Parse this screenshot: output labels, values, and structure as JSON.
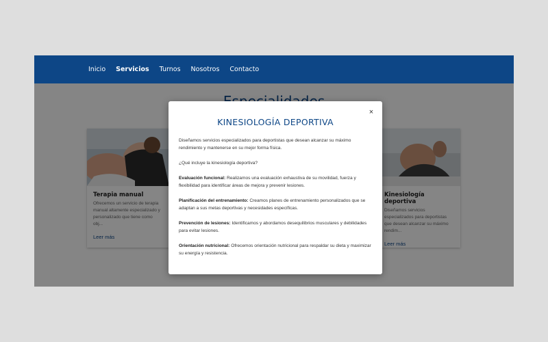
{
  "nav": {
    "items": [
      {
        "label": "Inicio",
        "active": false
      },
      {
        "label": "Servicios",
        "active": true
      },
      {
        "label": "Turnos",
        "active": false
      },
      {
        "label": "Nosotros",
        "active": false
      },
      {
        "label": "Contacto",
        "active": false
      }
    ]
  },
  "section": {
    "title": "Especialidades"
  },
  "cards": [
    {
      "title": "Terapia manual",
      "text": "Ofrecemos un servicio de terapia manual altamente especializado y personalizado que tiene como obj...",
      "link": "Leer más"
    },
    {
      "title": "Kinesiología deportiva",
      "text": "Diseñamos servicios especializados para deportistas que desean alcanzar su máximo rendim...",
      "link": "Leer más"
    }
  ],
  "modal": {
    "title": "KINESIOLOGÍA DEPORTIVA",
    "close": "×",
    "intro": "Diseñamos servicios especializados para deportistas que desean alcanzar su máximo rendimiento y mantenerse en su mejor forma física.",
    "question": "¿Qué incluye la kinesiología deportiva?",
    "items": [
      {
        "heading": "Evaluación funcional:",
        "text": " Realizamos una evaluación exhaustiva de su movilidad, fuerza y flexibilidad para identificar áreas de mejora y prevenir lesiones."
      },
      {
        "heading": "Planificación del entrenamiento:",
        "text": " Creamos planes de entrenamiento personalizados que se adaptan a sus metas deportivas y necesidades específicas."
      },
      {
        "heading": "Prevención de lesiones:",
        "text": " Identificamos y abordamos desequilibrios musculares y debilidades para evitar lesiones."
      },
      {
        "heading": "Orientación nutricional:",
        "text": " Ofrecemos orientación nutricional para respaldar su dieta y maximizar su energía y resistencia."
      }
    ]
  },
  "colors": {
    "brand": "#0d4686",
    "overlay": "rgba(0,0,0,0.48)"
  }
}
